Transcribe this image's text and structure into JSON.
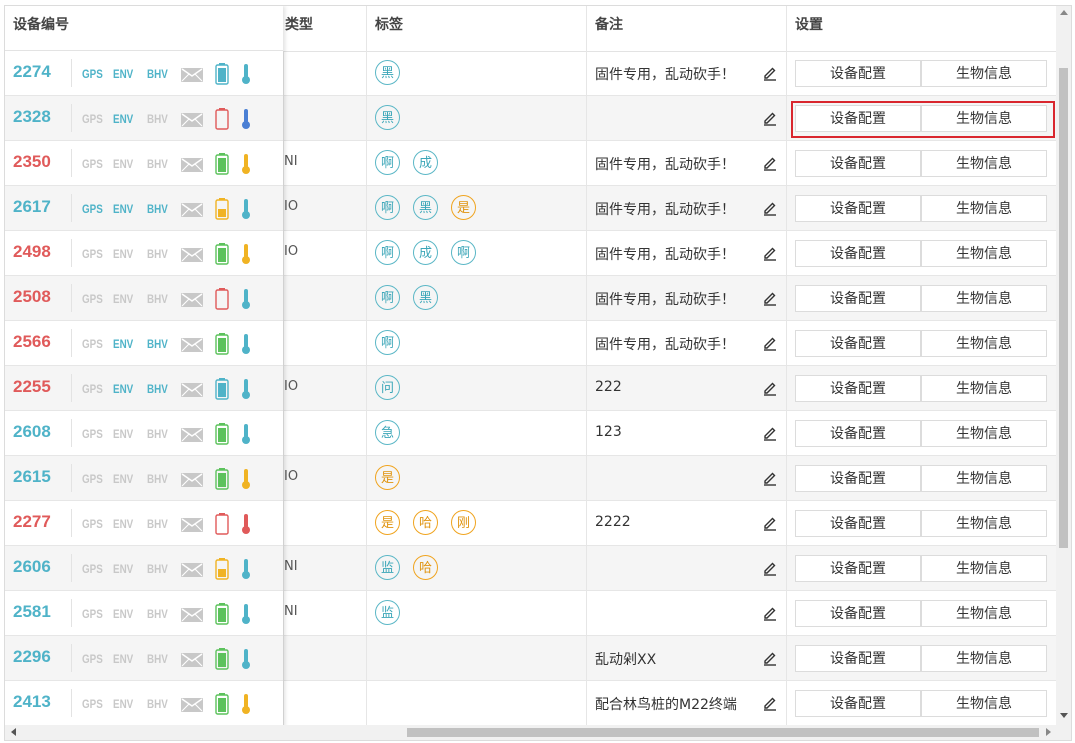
{
  "columns": {
    "device_id": "设备编号",
    "type": "类型",
    "tags": "标签",
    "note": "备注",
    "settings": "设置"
  },
  "indicators": {
    "gps": "GPS",
    "env": "ENV",
    "bhv": "BHV"
  },
  "buttons": {
    "config": "设备配置",
    "bio": "生物信息"
  },
  "colors": {
    "teal": "#4fb3c8",
    "red": "#e05a5a",
    "gray": "#c8c8c8",
    "green": "#5cc25c",
    "amber": "#f0b323",
    "tag_teal": "#5bb7c6",
    "tag_orange": "#f0a41f",
    "highlight": "#d9262e"
  },
  "rows": [
    {
      "id": "2274",
      "id_color": "teal",
      "gps": true,
      "env": true,
      "bhv": true,
      "battery": "teal",
      "thermo": "teal",
      "type": "",
      "tags": [
        {
          "t": "黑",
          "c": "teal"
        }
      ],
      "note": "固件专用，乱动砍手！"
    },
    {
      "id": "2328",
      "id_color": "teal",
      "gps": false,
      "env": true,
      "bhv": false,
      "battery": "red-outline",
      "thermo": "blue",
      "type": "",
      "tags": [
        {
          "t": "黑",
          "c": "teal"
        }
      ],
      "note": "",
      "highlight": true
    },
    {
      "id": "2350",
      "id_color": "red",
      "gps": false,
      "env": false,
      "bhv": false,
      "battery": "green",
      "thermo": "amber",
      "type": "NI",
      "tags": [
        {
          "t": "啊",
          "c": "teal"
        },
        {
          "t": "成",
          "c": "teal"
        }
      ],
      "note": "固件专用，乱动砍手！"
    },
    {
      "id": "2617",
      "id_color": "teal",
      "gps": true,
      "env": true,
      "bhv": true,
      "battery": "amber",
      "thermo": "teal",
      "type": "IO",
      "tags": [
        {
          "t": "啊",
          "c": "teal"
        },
        {
          "t": "黑",
          "c": "teal"
        },
        {
          "t": "是",
          "c": "orange"
        }
      ],
      "note": "固件专用，乱动砍手！"
    },
    {
      "id": "2498",
      "id_color": "red",
      "gps": false,
      "env": false,
      "bhv": false,
      "battery": "green",
      "thermo": "amber",
      "type": "IO",
      "tags": [
        {
          "t": "啊",
          "c": "teal"
        },
        {
          "t": "成",
          "c": "teal"
        },
        {
          "t": "啊",
          "c": "teal"
        }
      ],
      "note": "固件专用，乱动砍手！"
    },
    {
      "id": "2508",
      "id_color": "red",
      "gps": false,
      "env": false,
      "bhv": false,
      "battery": "red-outline",
      "thermo": "teal",
      "type": "",
      "tags": [
        {
          "t": "啊",
          "c": "teal"
        },
        {
          "t": "黑",
          "c": "teal"
        }
      ],
      "note": "固件专用，乱动砍手！"
    },
    {
      "id": "2566",
      "id_color": "red",
      "gps": false,
      "env": true,
      "bhv": true,
      "battery": "green",
      "thermo": "teal",
      "type": "",
      "tags": [
        {
          "t": "啊",
          "c": "teal"
        }
      ],
      "note": "固件专用，乱动砍手！"
    },
    {
      "id": "2255",
      "id_color": "red",
      "gps": false,
      "env": true,
      "bhv": true,
      "battery": "teal",
      "thermo": "teal",
      "type": "IO",
      "tags": [
        {
          "t": "问",
          "c": "teal"
        }
      ],
      "note": "222"
    },
    {
      "id": "2608",
      "id_color": "teal",
      "gps": false,
      "env": false,
      "bhv": false,
      "battery": "green",
      "thermo": "teal",
      "type": "",
      "tags": [
        {
          "t": "急",
          "c": "teal"
        }
      ],
      "note": "123"
    },
    {
      "id": "2615",
      "id_color": "teal",
      "gps": false,
      "env": false,
      "bhv": false,
      "battery": "green",
      "thermo": "amber",
      "type": "IO",
      "tags": [
        {
          "t": "是",
          "c": "orange"
        }
      ],
      "note": ""
    },
    {
      "id": "2277",
      "id_color": "red",
      "gps": false,
      "env": false,
      "bhv": false,
      "battery": "red-outline",
      "thermo": "red",
      "type": "",
      "tags": [
        {
          "t": "是",
          "c": "orange"
        },
        {
          "t": "哈",
          "c": "orange"
        },
        {
          "t": "刚",
          "c": "orange"
        }
      ],
      "note": "2222"
    },
    {
      "id": "2606",
      "id_color": "teal",
      "gps": false,
      "env": false,
      "bhv": false,
      "battery": "amber",
      "thermo": "teal",
      "type": "NI",
      "tags": [
        {
          "t": "监",
          "c": "teal"
        },
        {
          "t": "哈",
          "c": "orange"
        }
      ],
      "note": ""
    },
    {
      "id": "2581",
      "id_color": "teal",
      "gps": false,
      "env": false,
      "bhv": false,
      "battery": "green",
      "thermo": "teal",
      "type": "NI",
      "tags": [
        {
          "t": "监",
          "c": "teal"
        }
      ],
      "note": ""
    },
    {
      "id": "2296",
      "id_color": "teal",
      "gps": false,
      "env": false,
      "bhv": false,
      "battery": "green",
      "thermo": "teal",
      "type": "",
      "tags": [],
      "note": "乱动剁XX"
    },
    {
      "id": "2413",
      "id_color": "teal",
      "gps": false,
      "env": false,
      "bhv": false,
      "battery": "green",
      "thermo": "amber",
      "type": "",
      "tags": [],
      "note": "配合林鸟桩的M22终端"
    }
  ]
}
